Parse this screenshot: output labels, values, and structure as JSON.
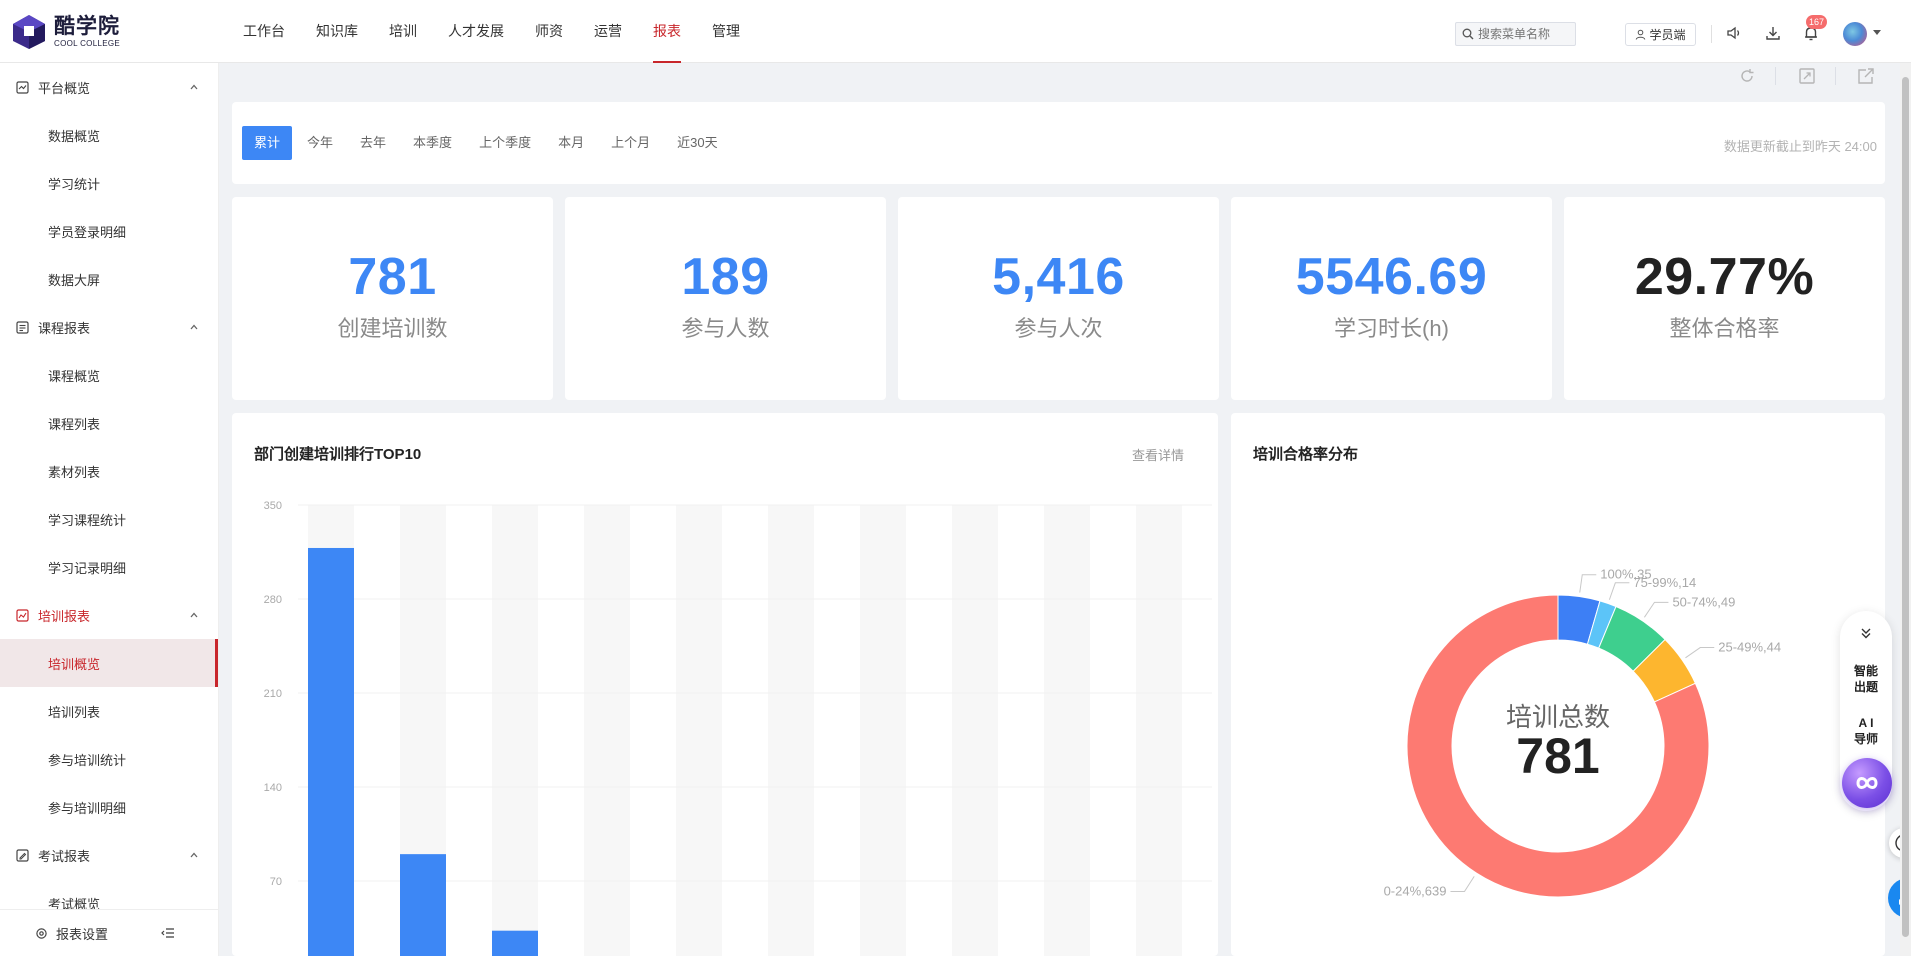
{
  "brand": {
    "name_cn": "酷学院",
    "name_en": "COOL COLLEGE"
  },
  "nav": [
    {
      "label": "工作台"
    },
    {
      "label": "知识库"
    },
    {
      "label": "培训"
    },
    {
      "label": "人才发展"
    },
    {
      "label": "师资"
    },
    {
      "label": "运营"
    },
    {
      "label": "报表",
      "active": true
    },
    {
      "label": "管理"
    }
  ],
  "header": {
    "search_placeholder": "搜索菜单名称",
    "student_label": "学员端",
    "notification_count": "167"
  },
  "sidebar": {
    "groups": [
      {
        "label": "平台概览",
        "items": [
          "数据概览",
          "学习统计",
          "学员登录明细",
          "数据大屏"
        ]
      },
      {
        "label": "课程报表",
        "items": [
          "课程概览",
          "课程列表",
          "素材列表",
          "学习课程统计",
          "学习记录明细"
        ]
      },
      {
        "label": "培训报表",
        "active": true,
        "items": [
          "培训概览",
          "培训列表",
          "参与培训统计",
          "参与培训明细"
        ]
      },
      {
        "label": "考试报表",
        "items": [
          "考试概览"
        ]
      }
    ],
    "active_item": "培训概览",
    "footer_label": "报表设置"
  },
  "filters": {
    "tabs": [
      "累计",
      "今年",
      "去年",
      "本季度",
      "上个季度",
      "本月",
      "上个月",
      "近30天"
    ],
    "active": "累计",
    "update_note": "数据更新截止到昨天  24:00"
  },
  "stats": [
    {
      "value": "781",
      "label": "创建培训数"
    },
    {
      "value": "189",
      "label": "参与人数"
    },
    {
      "value": "5,416",
      "label": "参与人次"
    },
    {
      "value": "5546.69",
      "label": "学习时长(h)"
    },
    {
      "value": "29.77%",
      "label": "整体合格率"
    }
  ],
  "bar_panel": {
    "title": "部门创建培训排行TOP10",
    "link": "查看详情"
  },
  "pie_panel": {
    "title": "培训合格率分布",
    "center_label": "培训总数",
    "center_value": "781"
  },
  "floating": {
    "item1": "智能出题",
    "item2": "A I 导师"
  },
  "colors": {
    "accent": "#3d87f5",
    "active_nav": "#c8262b"
  },
  "chart_data": [
    {
      "type": "bar",
      "title": "部门创建培训排行TOP10",
      "ylim": [
        0,
        350
      ],
      "yticks": [
        70,
        140,
        210,
        280,
        350
      ],
      "values": [
        318,
        90,
        33,
        null,
        null,
        null,
        null,
        null,
        null,
        null
      ],
      "grid": true
    },
    {
      "type": "pie",
      "title": "培训合格率分布",
      "slices": [
        {
          "label": "100%",
          "value": 35,
          "color": "#3d7ff5"
        },
        {
          "label": "75-99%",
          "value": 14,
          "color": "#5cc4f8"
        },
        {
          "label": "50-74%",
          "value": 49,
          "color": "#3ecf8e"
        },
        {
          "label": "25-49%",
          "value": 44,
          "color": "#fdb62f"
        },
        {
          "label": "0-24%",
          "value": 639,
          "color": "#fd7a72"
        }
      ]
    }
  ]
}
